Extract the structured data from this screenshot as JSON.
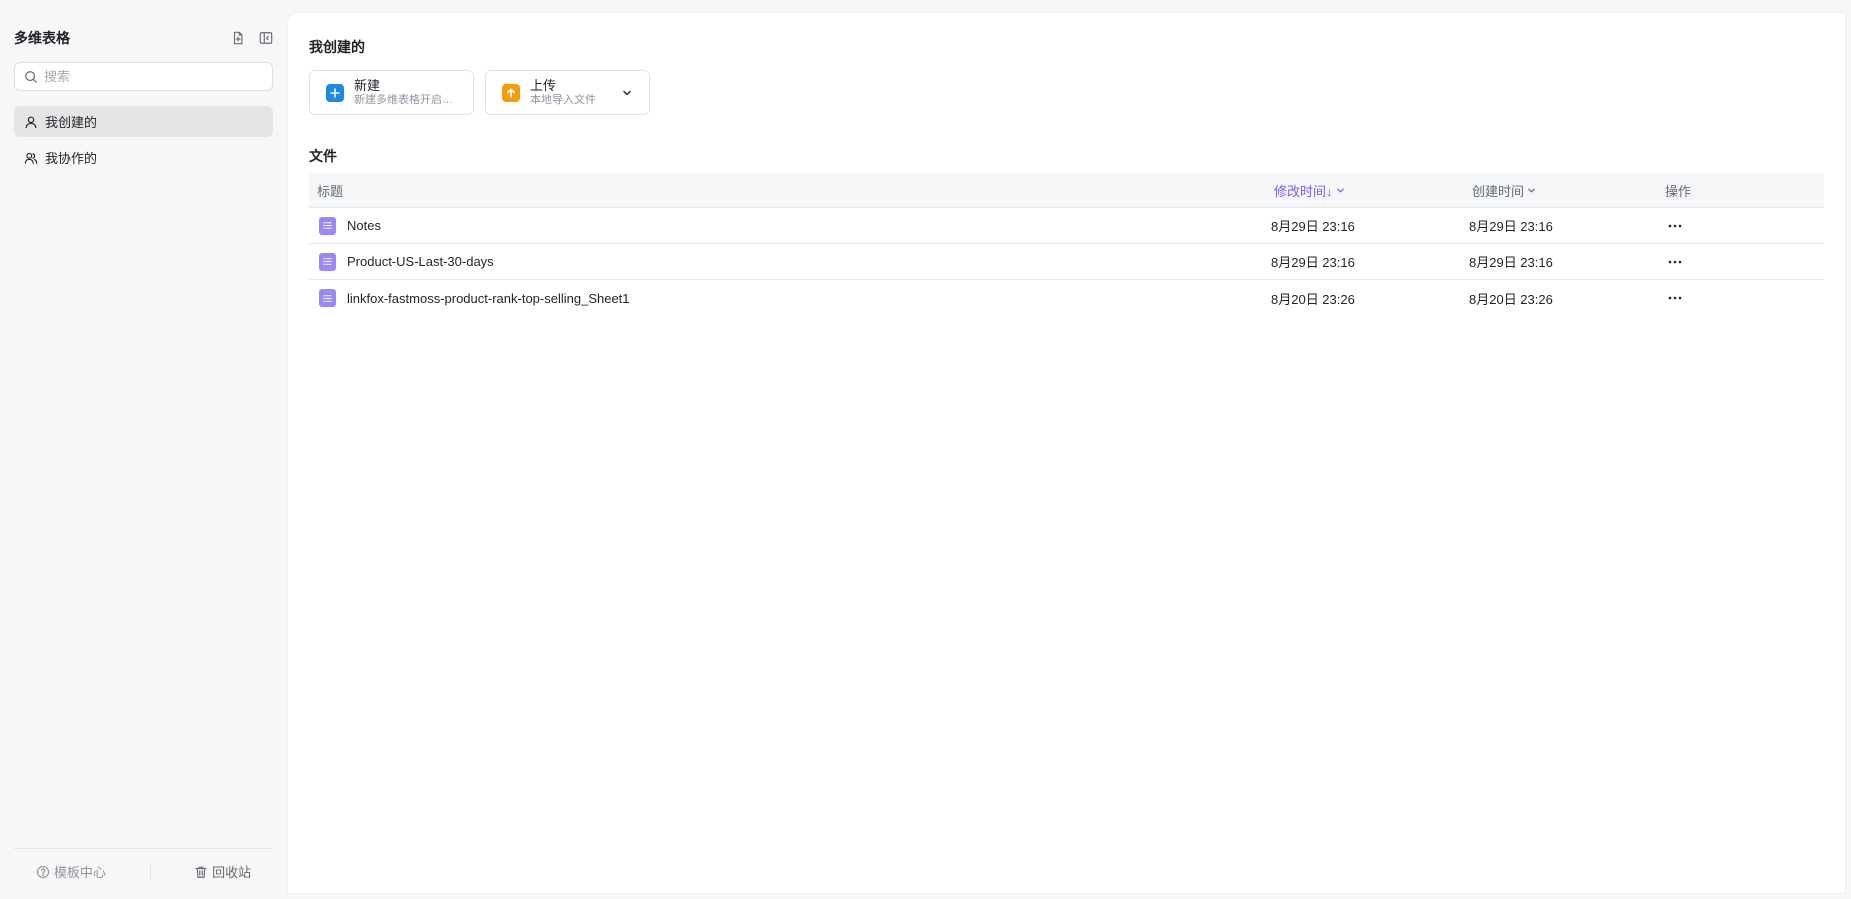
{
  "sidebar": {
    "title": "多维表格",
    "search_placeholder": "搜索",
    "nav": [
      {
        "label": "我创建的",
        "active": true
      },
      {
        "label": "我协作的",
        "active": false
      }
    ],
    "footer": {
      "templates": "模板中心",
      "trash": "回收站"
    }
  },
  "main": {
    "title": "我创建的",
    "cards": {
      "new": {
        "name": "新建",
        "desc": "新建多维表格开启协作",
        "icon_color": "#1e88e5"
      },
      "upload": {
        "name": "上传",
        "desc": "本地导入文件",
        "icon_color": "#f59e0b"
      }
    },
    "section_title": "文件",
    "table": {
      "columns": {
        "title": "标题",
        "modified": "修改时间↓",
        "created": "创建时间",
        "actions": "操作"
      },
      "rows": [
        {
          "title": "Notes",
          "modified": "8月29日 23:16",
          "created": "8月29日 23:16"
        },
        {
          "title": "Product-US-Last-30-days",
          "modified": "8月29日 23:16",
          "created": "8月29日 23:16"
        },
        {
          "title": "linkfox-fastmoss-product-rank-top-selling_Sheet1",
          "modified": "8月20日 23:26",
          "created": "8月20日 23:26"
        }
      ]
    }
  },
  "colors": {
    "accent": "#7b5ee6",
    "file_icon": "#9b87f5"
  },
  "icons": {
    "new_doc": "file-plus-icon",
    "collapse": "sidebar-collapse-icon",
    "search": "search-icon",
    "user": "user-icon",
    "users": "users-icon",
    "help": "question-circle-icon",
    "trash": "trash-icon",
    "more": "more-horizontal-icon",
    "sheet": "sheet-icon"
  }
}
